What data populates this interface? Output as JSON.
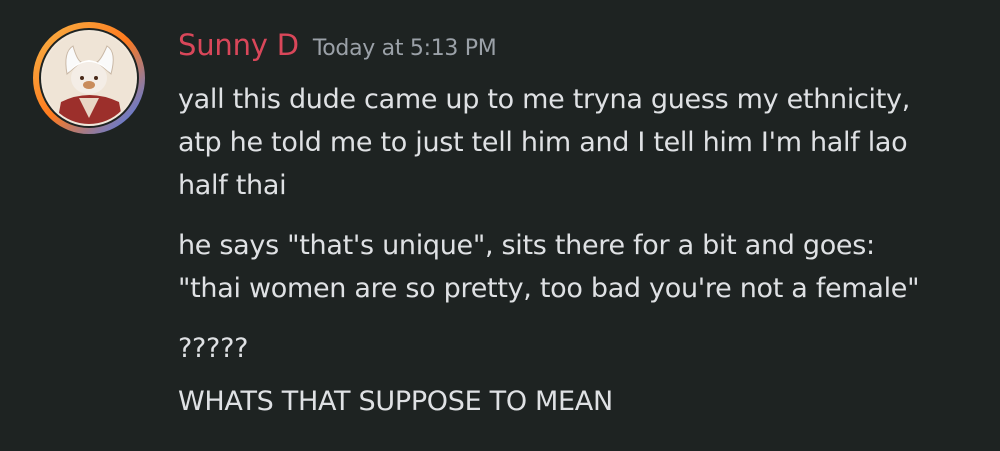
{
  "message": {
    "author": "Sunny D",
    "timestamp": "Today at 5:13 PM",
    "lines": [
      "yall this dude came up to me tryna guess my ethnicity,",
      "atp he told me to just tell him and I tell him I'm half lao",
      "half thai",
      "he says \"that's unique\", sits there for a bit and goes:",
      "\"thai women are so pretty, too bad you're not a female\"",
      "?????",
      "WHATS THAT SUPPOSE TO MEAN"
    ]
  },
  "colors": {
    "background": "#1e2322",
    "author": "#d9475a",
    "timestamp": "#9ba1a8",
    "text": "#dfe1e4"
  },
  "icons": {
    "avatar": "avatar-image"
  }
}
